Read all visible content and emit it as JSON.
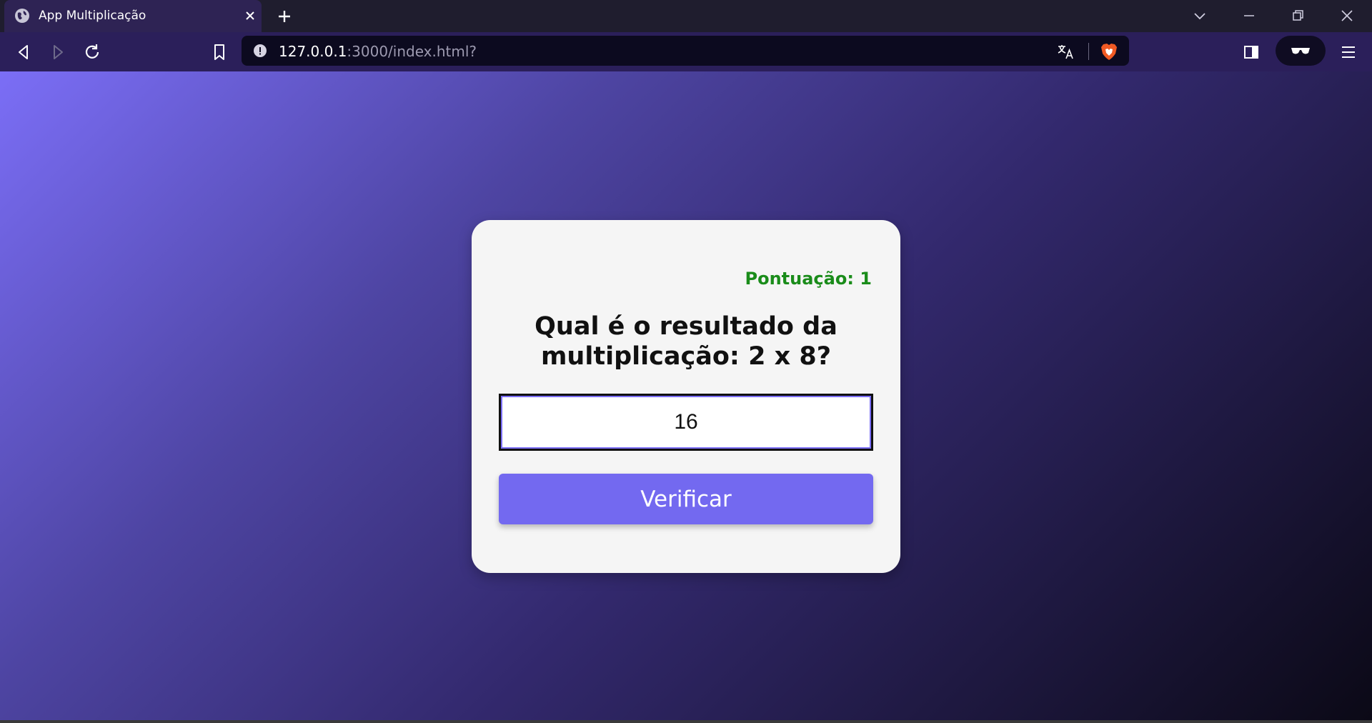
{
  "browser": {
    "tab": {
      "title": "App Multiplicação"
    },
    "address": {
      "host": "127.0.0.1",
      "rest": ":3000/index.html?"
    }
  },
  "app": {
    "score": "Pontuação: 1",
    "question": "Qual é o resultado da multiplicação: 2 x 8?",
    "answer_value": "16",
    "verify_label": "Verificar"
  },
  "colors": {
    "score": "#1a8c1a",
    "button": "#7369f0",
    "card": "#f5f5f5"
  }
}
